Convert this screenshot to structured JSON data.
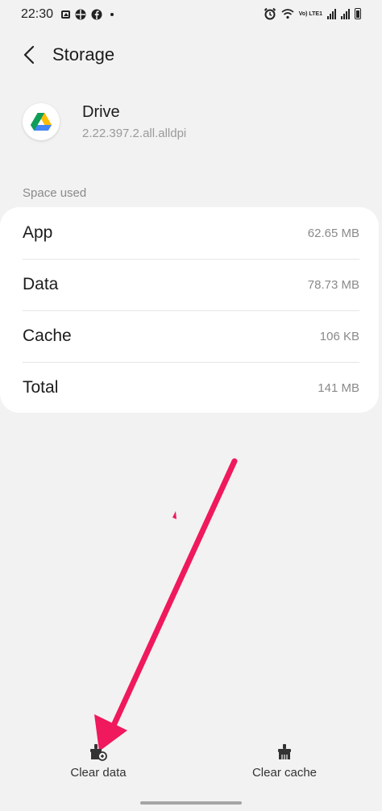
{
  "status_bar": {
    "time": "22:30",
    "network": "Vo) LTE1"
  },
  "header": {
    "title": "Storage"
  },
  "app": {
    "name": "Drive",
    "version": "2.22.397.2.all.alldpi"
  },
  "section_label": "Space used",
  "storage": [
    {
      "label": "App",
      "value": "62.65 MB"
    },
    {
      "label": "Data",
      "value": "78.73 MB"
    },
    {
      "label": "Cache",
      "value": "106 KB"
    },
    {
      "label": "Total",
      "value": "141 MB"
    }
  ],
  "actions": {
    "clear_data": "Clear data",
    "clear_cache": "Clear cache"
  },
  "colors": {
    "arrow": "#f0195d",
    "background": "#f2f2f2",
    "card": "#ffffff"
  },
  "icons": [
    "gallery-icon",
    "grid-icon",
    "facebook-icon",
    "alarm-icon",
    "wifi-icon",
    "signal-icon",
    "battery-icon",
    "back-arrow-icon",
    "google-drive-icon",
    "clear-data-icon",
    "clear-cache-icon"
  ]
}
